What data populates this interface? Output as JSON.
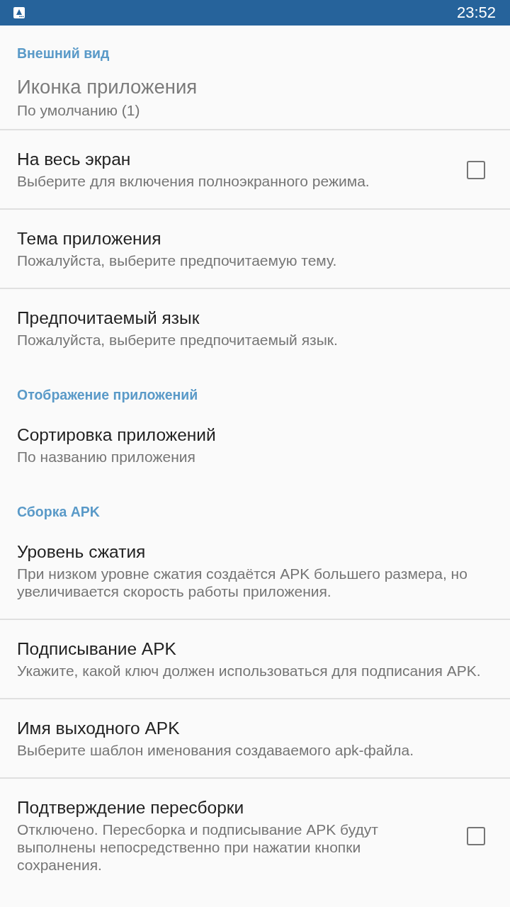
{
  "status_bar": {
    "time": "23:52"
  },
  "sections": [
    {
      "header": "Внешний вид",
      "items": [
        {
          "kind": "large",
          "title": "Иконка приложения",
          "summary": "По умолчанию (1)",
          "disabled": true
        },
        {
          "kind": "checkbox",
          "title": "На весь экран",
          "summary": "Выберите для включения полноэкранного режима.",
          "disabled": false,
          "checked": false
        },
        {
          "kind": "plain",
          "title": "Тема приложения",
          "summary": "Пожалуйста, выберите предпочитаемую тему.",
          "disabled": false
        },
        {
          "kind": "plain",
          "title": "Предпочитаемый язык",
          "summary": "Пожалуйста, выберите предпочитаемый язык.",
          "disabled": false
        }
      ]
    },
    {
      "header": "Отображение приложений",
      "items": [
        {
          "kind": "plain",
          "title": "Сортировка приложений",
          "summary": "По названию приложения",
          "disabled": false
        }
      ]
    },
    {
      "header": "Сборка APK",
      "items": [
        {
          "kind": "plain",
          "title": "Уровень сжатия",
          "summary": "При низком уровне сжатия создаётся APK большего размера, но увеличивается скорость работы приложения.",
          "disabled": false
        },
        {
          "kind": "plain",
          "title": "Подписывание APK",
          "summary": "Укажите, какой ключ должен использоваться для подписания APK.",
          "disabled": false
        },
        {
          "kind": "plain",
          "title": "Имя выходного APK",
          "summary": "Выберите шаблон именования создаваемого apk-файла.",
          "disabled": false
        },
        {
          "kind": "checkbox",
          "title": "Подтверждение пересборки",
          "summary": "Отключено. Пересборка и подписывание APK будут выполнены непосредственно при нажатии кнопки сохранения.",
          "disabled": false,
          "checked": false
        }
      ]
    }
  ]
}
